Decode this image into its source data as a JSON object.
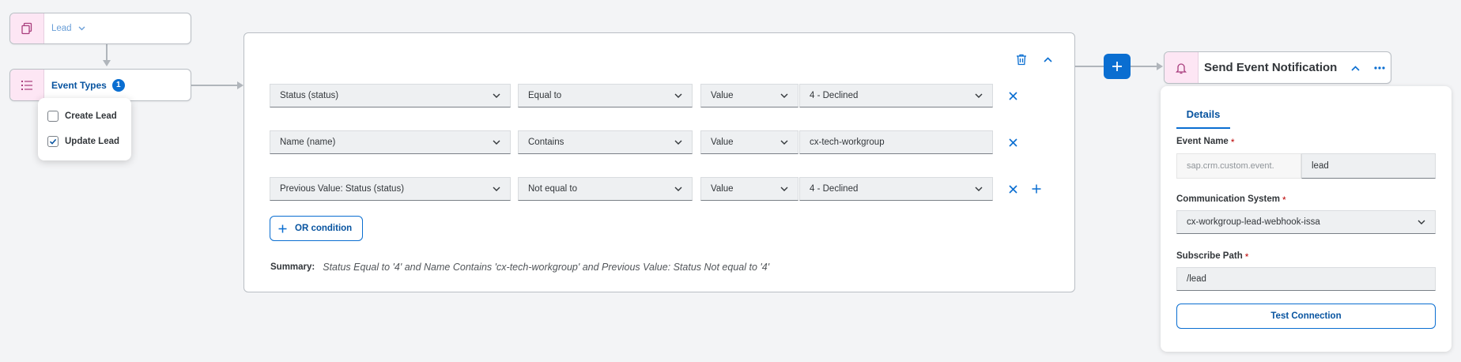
{
  "lead_node": {
    "label": "Lead",
    "icon": "copy-icon",
    "accent": "#a93e7d"
  },
  "event_types_node": {
    "label": "Event Types",
    "count": "1",
    "icon": "list-icon"
  },
  "event_types_popover": {
    "options": [
      {
        "label": "Create Lead",
        "checked": false
      },
      {
        "label": "Update Lead",
        "checked": true
      }
    ]
  },
  "condition_panel": {
    "rows": [
      {
        "field": "Status (status)",
        "operator": "Equal to",
        "value_type": "Value",
        "value": "4 - Declined",
        "value_is_select": true
      },
      {
        "field": "Name (name)",
        "operator": "Contains",
        "value_type": "Value",
        "value": "cx-tech-workgroup",
        "value_is_select": false
      },
      {
        "field": "Previous Value: Status (status)",
        "operator": "Not equal to",
        "value_type": "Value",
        "value": "4 - Declined",
        "value_is_select": true
      }
    ],
    "or_condition_label": "OR condition",
    "summary_label": "Summary:",
    "summary_text": "Status Equal to '4' and Name Contains 'cx-tech-workgroup' and Previous Value: Status Not equal to '4'"
  },
  "notification_node": {
    "title": "Send Event Notification",
    "icon": "bell-icon"
  },
  "details_panel": {
    "tab": "Details",
    "event_name": {
      "label": "Event Name",
      "prefix": "sap.crm.custom.event.",
      "value": "lead"
    },
    "communication_system": {
      "label": "Communication System",
      "value": "cx-workgroup-lead-webhook-issa"
    },
    "subscribe_path": {
      "label": "Subscribe Path",
      "value": "/lead"
    },
    "test_button": "Test Connection",
    "required_mark": "*"
  },
  "colors": {
    "accent_blue": "#0a6ed1",
    "link_blue": "#0854a0",
    "icon_bg": "#fde6f4",
    "required": "#bb0000",
    "background": "#f3f4f6"
  }
}
